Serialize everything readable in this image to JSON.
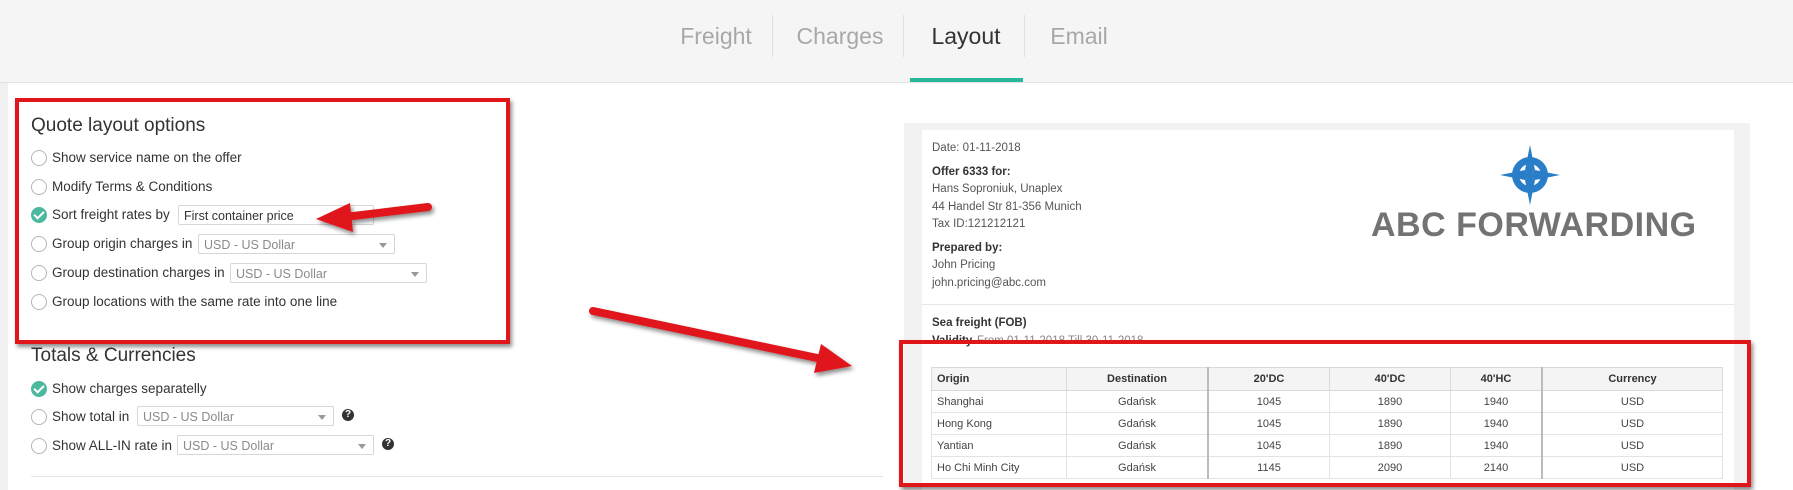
{
  "tabs": [
    {
      "label": "Freight",
      "active": false
    },
    {
      "label": "Charges",
      "active": false
    },
    {
      "label": "Layout",
      "active": true
    },
    {
      "label": "Email",
      "active": false
    }
  ],
  "accent_color": "#2ab69a",
  "annotation_color": "#e0161b",
  "layout_options": {
    "title": "Quote layout options",
    "items": [
      {
        "label": "Show service name on the offer",
        "checked": false
      },
      {
        "label": "Modify Terms & Conditions",
        "checked": false
      },
      {
        "label": "Sort freight rates by",
        "checked": true,
        "select": "First container price"
      },
      {
        "label": "Group origin charges in",
        "checked": false,
        "select": "USD - US Dollar"
      },
      {
        "label": "Group destination charges in",
        "checked": false,
        "select": "USD - US Dollar"
      },
      {
        "label": "Group locations with the same rate into one line",
        "checked": false
      }
    ]
  },
  "totals": {
    "title": "Totals & Currencies",
    "items": [
      {
        "label": "Show charges separatelly",
        "checked": true
      },
      {
        "label": "Show total in",
        "checked": false,
        "select": "USD - US Dollar",
        "help": "?"
      },
      {
        "label": "Show ALL-IN rate in",
        "checked": false,
        "select": "USD - US Dollar",
        "help": "?"
      }
    ]
  },
  "preview": {
    "date": "Date: 01-11-2018",
    "offer_title": "Offer 6333 for:",
    "client_name": "Hans Soproniuk, Unaplex",
    "client_address": "44 Handel Str 81-356 Munich",
    "tax_id": "Tax ID:121212121",
    "prepared_by_label": "Prepared by:",
    "prepared_by_name": "John Pricing",
    "prepared_by_email": "john.pricing@abc.com",
    "logo_text": "ABC FORWARDING",
    "logo_icon": "compass-icon",
    "section_title": "Sea freight (FOB)",
    "validity_label": "Validity",
    "validity_text": "From 01-11-2018 Till 30-11-2018",
    "table": {
      "headers": [
        "Origin",
        "Destination",
        "20'DC",
        "40'DC",
        "40'HC",
        "Currency"
      ],
      "rows": [
        [
          "Shanghai",
          "Gdańsk",
          "1045",
          "1890",
          "1940",
          "USD"
        ],
        [
          "Hong Kong",
          "Gdańsk",
          "1045",
          "1890",
          "1940",
          "USD"
        ],
        [
          "Yantian",
          "Gdańsk",
          "1045",
          "1890",
          "1940",
          "USD"
        ],
        [
          "Ho Chi Minh City",
          "Gdańsk",
          "1145",
          "2090",
          "2140",
          "USD"
        ]
      ]
    }
  }
}
